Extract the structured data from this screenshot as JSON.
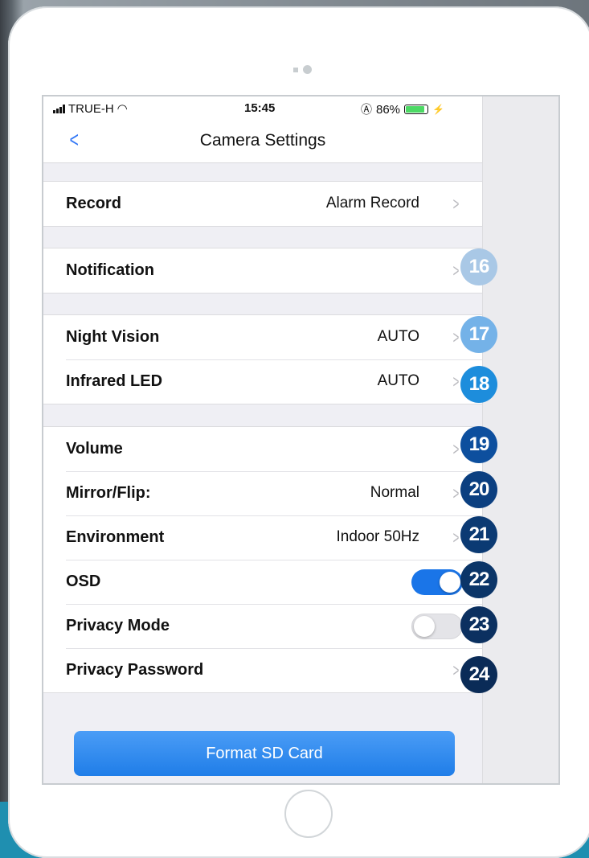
{
  "status_bar": {
    "carrier": "TRUE-H",
    "time": "15:45",
    "battery_percent": "86%"
  },
  "nav": {
    "back_icon": "chevron-left-icon",
    "title": "Camera Settings"
  },
  "groups": [
    {
      "rows": [
        {
          "label": "Record",
          "value": "Alarm Record"
        }
      ]
    },
    {
      "rows": [
        {
          "label": "Notification",
          "value": ""
        }
      ]
    },
    {
      "rows": [
        {
          "label": "Night Vision",
          "value": "AUTO"
        },
        {
          "label": "Infrared LED",
          "value": "AUTO"
        }
      ]
    },
    {
      "rows": [
        {
          "label": "Volume",
          "value": ""
        },
        {
          "label": "Mirror/Flip:",
          "value": "Normal"
        },
        {
          "label": "Environment",
          "value": "Indoor 50Hz"
        },
        {
          "label": "OSD",
          "toggle": true
        },
        {
          "label": "Privacy Mode",
          "toggle": false
        },
        {
          "label": "Privacy Password",
          "value": ""
        }
      ]
    }
  ],
  "format_button": "Format SD Card",
  "badges": [
    "16",
    "17",
    "18",
    "19",
    "20",
    "21",
    "22",
    "23",
    "24"
  ],
  "colors": {
    "accent": "#1a75e8",
    "badge_light": "#a9c8e6",
    "badge_mid": "#4aa3e6",
    "badge_dark": "#0b2e5e"
  }
}
